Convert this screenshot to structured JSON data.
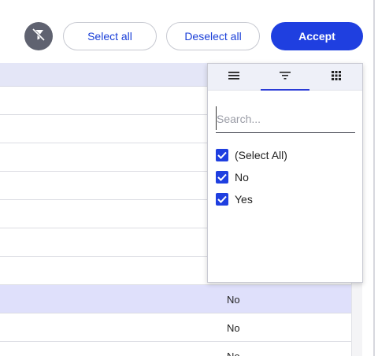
{
  "toolbar": {
    "select_all_label": "Select all",
    "deselect_all_label": "Deselect all",
    "accept_label": "Accept"
  },
  "grid": {
    "visible_values": [
      "No",
      "No",
      "No"
    ]
  },
  "filter_popup": {
    "tabs": [
      "general-menu",
      "filter",
      "columns"
    ],
    "active_tab": "filter",
    "search_placeholder": "Search...",
    "options": [
      {
        "label": "(Select All)",
        "checked": true
      },
      {
        "label": "No",
        "checked": true
      },
      {
        "label": "Yes",
        "checked": true
      }
    ]
  },
  "colors": {
    "accent": "#1f3fe0",
    "selected_row": "#dfe0fb",
    "header": "#e4e6f7",
    "clear_button": "#5f6270"
  }
}
